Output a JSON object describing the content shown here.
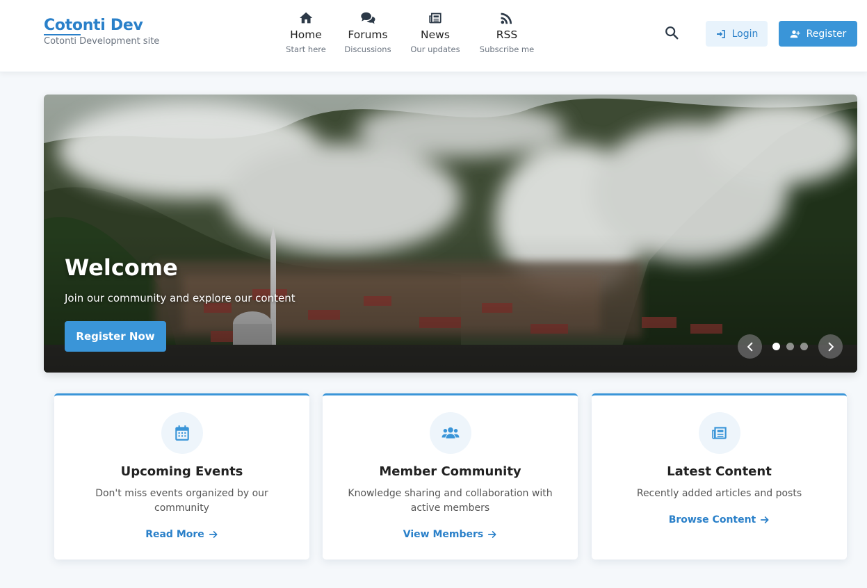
{
  "brand": {
    "title": "Cotonti Dev",
    "subtitle": "Cotonti Development site"
  },
  "nav": [
    {
      "icon": "home-icon",
      "label": "Home",
      "sub": "Start here"
    },
    {
      "icon": "comments-icon",
      "label": "Forums",
      "sub": "Discussions"
    },
    {
      "icon": "newspaper-icon",
      "label": "News",
      "sub": "Our updates"
    },
    {
      "icon": "rss-icon",
      "label": "RSS",
      "sub": "Subscribe me"
    }
  ],
  "header": {
    "search_icon": "search-icon",
    "login_label": "Login",
    "register_label": "Register"
  },
  "hero": {
    "title": "Welcome",
    "subtitle": "Join our community and explore our content",
    "cta_label": "Register Now",
    "slides_count": 3,
    "active_slide": 1
  },
  "cards": [
    {
      "icon": "calendar-icon",
      "title": "Upcoming Events",
      "description": "Don't miss events organized by our community",
      "link_label": "Read More"
    },
    {
      "icon": "users-icon",
      "title": "Member Community",
      "description": "Knowledge sharing and collaboration with active members",
      "link_label": "View Members"
    },
    {
      "icon": "newspaper-icon",
      "title": "Latest Content",
      "description": "Recently added articles and posts",
      "link_label": "Browse Content"
    }
  ],
  "colors": {
    "accent": "#3a95d8",
    "brand": "#2a80c9",
    "background": "#f5f8fb"
  }
}
